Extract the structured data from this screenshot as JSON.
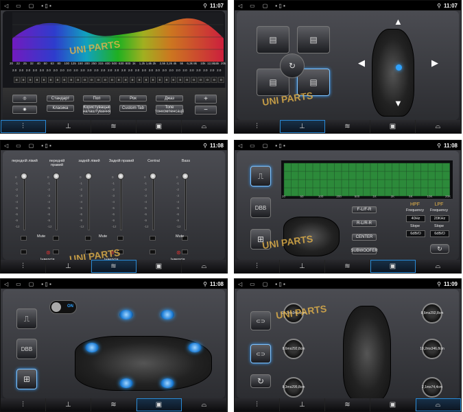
{
  "status": {
    "times": [
      "11:07",
      "11:07",
      "11:08",
      "11:08",
      "11:08",
      "11:09"
    ]
  },
  "watermark": {
    "text": "UNI PARTS"
  },
  "panel1": {
    "eq_x_labels": [
      "20",
      "22",
      "25",
      "32",
      "40",
      "50",
      "63",
      "80",
      "100",
      "125",
      "150",
      "200",
      "250",
      "315",
      "400",
      "500",
      "630",
      "800",
      "1k",
      "1,2k",
      "1,6k",
      "2k",
      "2,5k",
      "3,2k",
      "4k",
      "5k",
      "6,3k",
      "8k",
      "10k",
      "12,5k",
      "16k",
      "20k"
    ],
    "row_values": [
      "2.0",
      "2.0",
      "2.0",
      "2.0",
      "2.0",
      "2.0",
      "2.0",
      "2.0",
      "2.0",
      "2.0",
      "2.0",
      "2.0",
      "2.0",
      "2.0",
      "2.0",
      "2.0",
      "2.0",
      "2.0",
      "2.0",
      "2.0",
      "2.0",
      "2.0",
      "2.0",
      "2.0",
      "2.0",
      "2.0",
      "2.0",
      "2.0",
      "2.0",
      "2.0",
      "2.0"
    ],
    "row_db": [
      "0",
      "0",
      "0",
      "0",
      "0",
      "0",
      "0",
      "0",
      "0",
      "0",
      "0",
      "0",
      "0",
      "0",
      "0",
      "0",
      "0",
      "0",
      "0",
      "0",
      "0",
      "0",
      "0",
      "0",
      "0",
      "0",
      "0",
      "0",
      "0",
      "0",
      "0"
    ],
    "presets": [
      "Стандарт",
      "Поп",
      "Рок",
      "Джаз",
      "Класика",
      "Користувацькі налаштування",
      "Custom Tab",
      "Tone тонкомпенсації"
    ],
    "plus": "+",
    "minus": "−"
  },
  "panel3": {
    "channels": [
      {
        "name": "передній лівий"
      },
      {
        "name": "передній правий"
      },
      {
        "name": "задній лівий"
      },
      {
        "name": "Задній правий"
      },
      {
        "name": "Central"
      },
      {
        "name": "Bass"
      }
    ],
    "mute": "Mute",
    "inverse": "Інверсія",
    "ticks": [
      "0",
      "-1",
      "-2",
      "-3",
      "-4",
      "-5",
      "-6",
      "-9",
      "-12"
    ]
  },
  "panel4": {
    "chart_x": [
      "20",
      "50",
      "100",
      "200",
      "500",
      "1K",
      "2K",
      "5K",
      "10K",
      "20K"
    ],
    "channel_buttons": [
      "F-L/F-R",
      "R-L/R-R",
      "CENTER",
      "SUBWOOFER"
    ],
    "hpf": "HPF",
    "lpf": "LPF",
    "frequency": "Frequency",
    "hpf_freq": "40Hz",
    "lpf_freq": "20KHz",
    "slope": "Slope",
    "hpf_slope": "6dB/O",
    "lpf_slope": "6dB/O"
  },
  "panel5": {
    "toggle": "ON"
  },
  "panel6": {
    "knobs": [
      {
        "ms": "10,2ms",
        "cm": "346,8cm"
      },
      {
        "ms": "8,6ms",
        "cm": "292,8cm"
      },
      {
        "ms": "8,6ms",
        "cm": "292,8cm"
      },
      {
        "ms": "10,2ms",
        "cm": "346,8cm"
      },
      {
        "ms": "8,3ms",
        "cm": "295,8cm"
      },
      {
        "ms": "2,1ms",
        "cm": "74,4cm"
      }
    ]
  }
}
